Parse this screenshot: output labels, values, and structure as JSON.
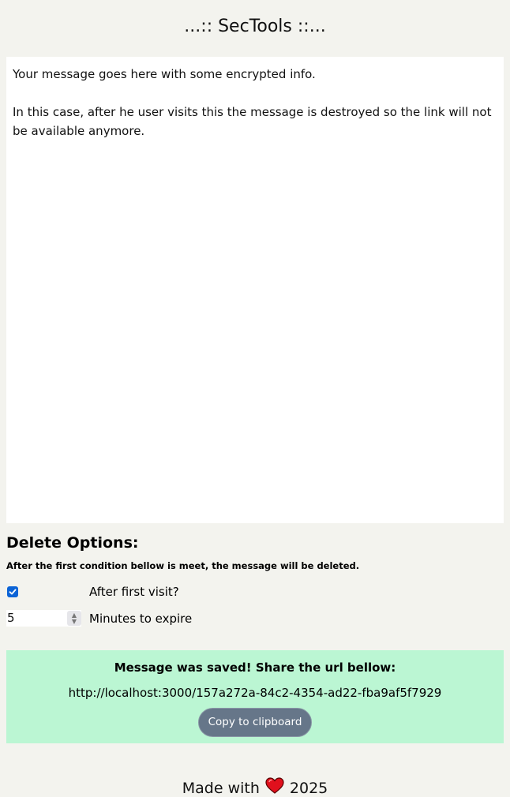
{
  "header": {
    "title": "...:: SecTools ::..."
  },
  "message": {
    "text": "Your message goes here with some encrypted info.\n\nIn this case, after he user visits this the message is destroyed so the link will not be available anymore."
  },
  "delete_options": {
    "heading": "Delete Options:",
    "note": "After the first condition bellow is meet, the message will be deleted.",
    "after_first_visit": {
      "label": "After first visit?",
      "checked": true
    },
    "minutes": {
      "value": "5",
      "label": "Minutes to expire"
    }
  },
  "result": {
    "title": "Message was saved! Share the url bellow:",
    "url": "http://localhost:3000/157a272a-84c2-4354-ad22-fba9af5f7929",
    "copy_label": "Copy to clipboard"
  },
  "footer": {
    "prefix": "Made with",
    "icon": "heart-icon",
    "year": "2025"
  },
  "colors": {
    "background": "#f3f3ee",
    "success_panel": "#bbf6d3",
    "button": "#667689",
    "checkbox": "#0b63d6",
    "heart": "#e0101c"
  }
}
